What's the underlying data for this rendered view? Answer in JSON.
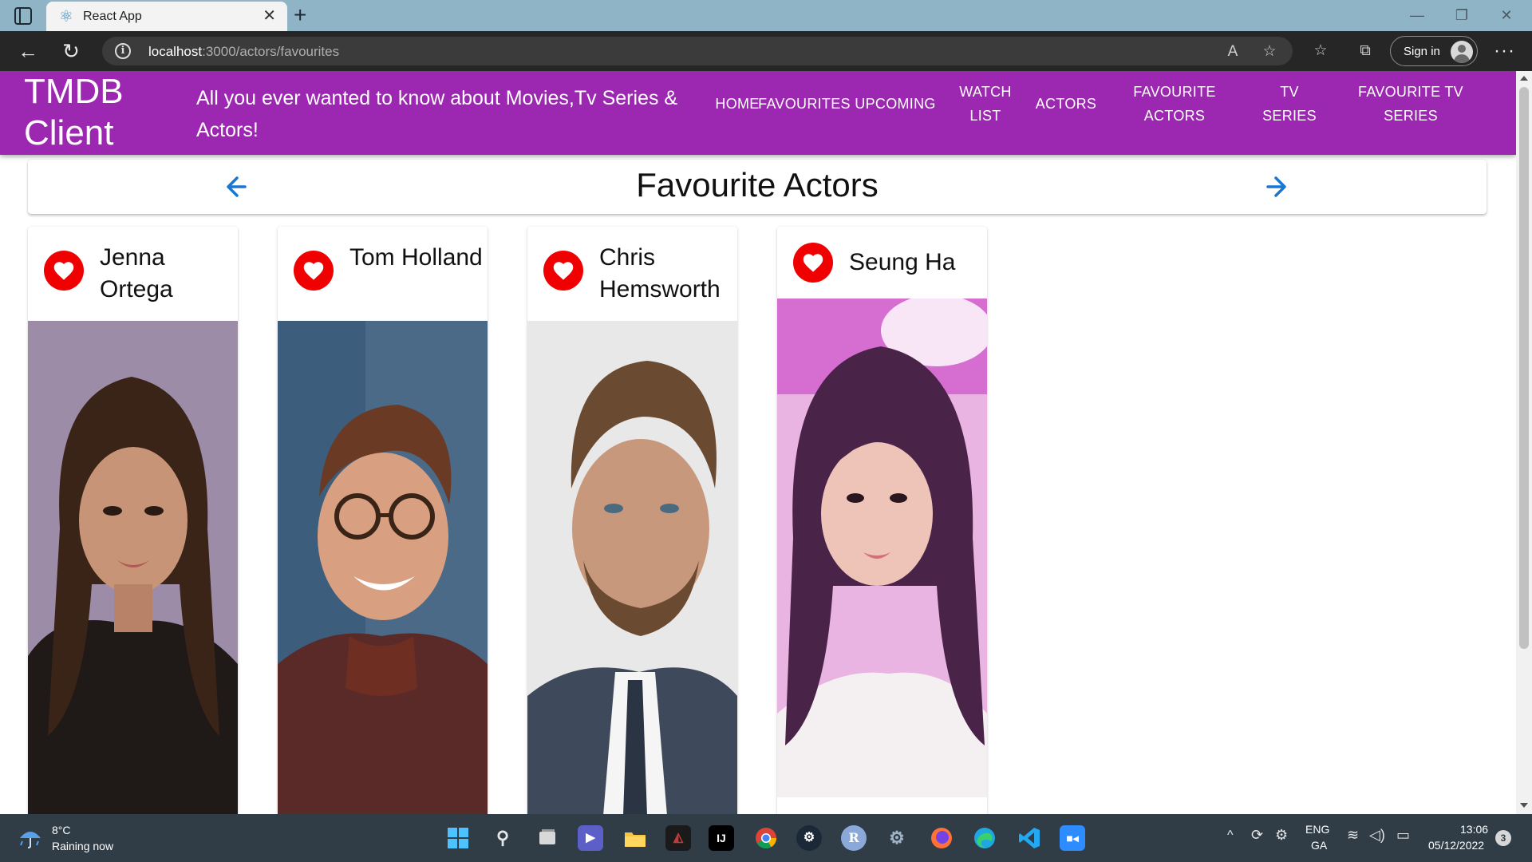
{
  "browser": {
    "tab_title": "React App",
    "url_host": "localhost",
    "url_path": ":3000/actors/favourites",
    "sign_in_label": "Sign in"
  },
  "appbar": {
    "brand": "TMDB Client",
    "tagline": "All you ever wanted to know about Movies,Tv Series & Actors!",
    "nav": [
      "HOME",
      "FAVOURITES",
      "UPCOMING",
      "WATCH LIST",
      "ACTORS",
      "FAVOURITE ACTORS",
      "TV SERIES",
      "FAVOURITE TV SERIES"
    ]
  },
  "header": {
    "title": "Favourite Actors",
    "back_icon": "arrow-left-icon",
    "forward_icon": "arrow-right-icon"
  },
  "actors": [
    {
      "name": "Jenna Ortega",
      "icon": "heart-icon"
    },
    {
      "name": "Tom Holland",
      "icon": "heart-icon"
    },
    {
      "name": "Chris Hemsworth",
      "icon": "heart-icon"
    },
    {
      "name": "Seung Ha",
      "icon": "heart-icon"
    }
  ],
  "taskbar": {
    "weather_temp": "8°C",
    "weather_desc": "Raining now",
    "lang_top": "ENG",
    "lang_bottom": "GA",
    "time": "13:06",
    "date": "05/12/2022",
    "notification_count": "3"
  },
  "colors": {
    "appbar": "#9c27b0",
    "accent_blue": "#1976d2",
    "heart_red": "#f00000"
  }
}
